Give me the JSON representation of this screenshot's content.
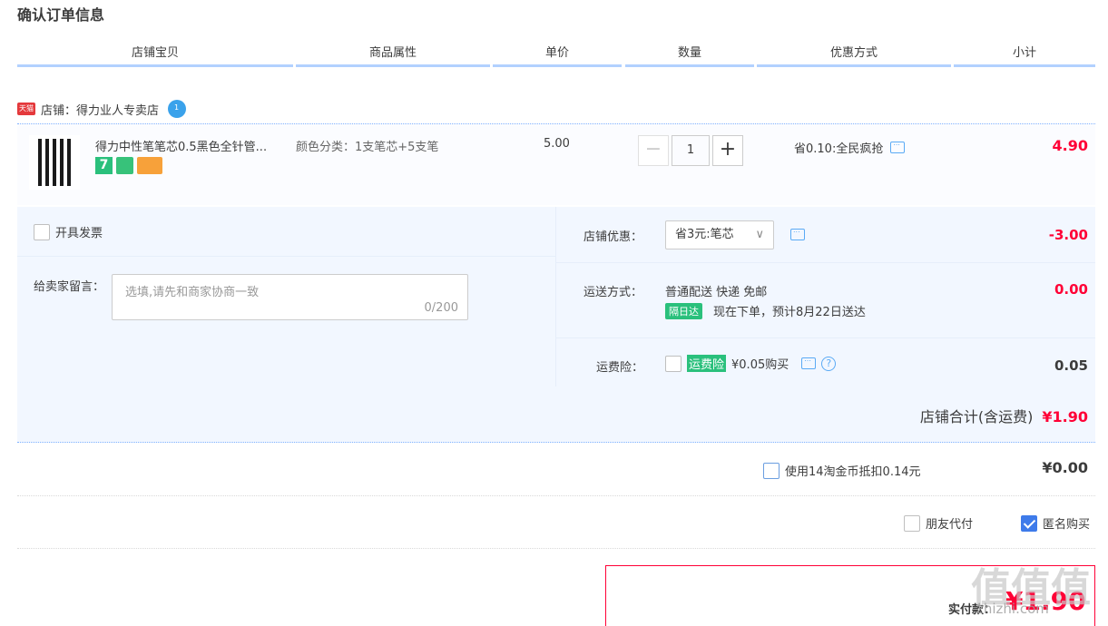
{
  "page": {
    "title": "确认订单信息"
  },
  "columns": [
    "店铺宝贝",
    "商品属性",
    "单价",
    "数量",
    "优惠方式",
    "小计"
  ],
  "shop": {
    "badge": "天猫",
    "label": "店铺：得力业人专卖店"
  },
  "item": {
    "title": "得力中性笔笔芯0.5黑色全针管...",
    "badge7": "7",
    "attr": "颜色分类：1支笔芯+5支笔",
    "price": "5.00",
    "qty": "1",
    "minus": "−",
    "plus": "+",
    "promo": "省0.10:全民疯抢",
    "subtotal": "4.90"
  },
  "invoice": {
    "label": "开具发票"
  },
  "memo": {
    "label": "给卖家留言：",
    "placeholder": "选填,请先和商家协商一致",
    "count": "0/200"
  },
  "shop_discount": {
    "label": "店铺优惠：",
    "selected": "省3元:笔芯",
    "amount": "-3.00"
  },
  "shipping": {
    "label": "运送方式：",
    "method": "普通配送 快递 免邮",
    "tag": "隔日达",
    "eta": "现在下单，预计8月22日送达",
    "amount": "0.00"
  },
  "insurance": {
    "label": "运费险：",
    "tag": "运费险",
    "price": "¥0.05购买",
    "amount": "0.05"
  },
  "shop_total": {
    "label": "店铺合计(含运费)",
    "amount": "¥1.90"
  },
  "coins": {
    "label": "使用14淘金币抵扣0.14元",
    "amount": "¥0.00"
  },
  "options": {
    "friend_pay": "朋友代付",
    "anonymous": "匿名购买",
    "anonymous_checked": true
  },
  "payment": {
    "label": "实付款：",
    "amount": "¥1.90"
  },
  "watermark": {
    "main": "值值值",
    "sub": "zhizhi.com"
  }
}
